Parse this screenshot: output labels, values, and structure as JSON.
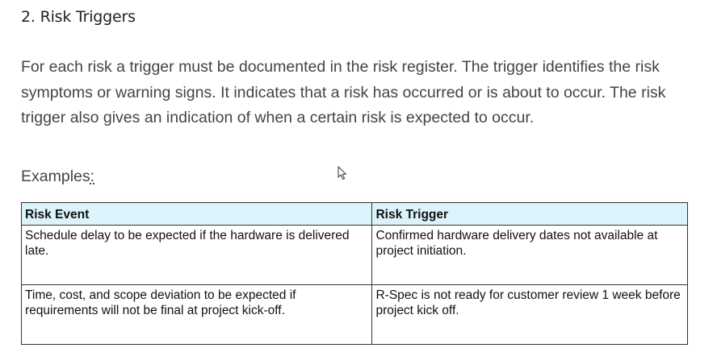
{
  "section": {
    "heading": "2. Risk Triggers",
    "paragraph": "For each risk a trigger must be documented in the risk register. The trigger identifies the risk symptoms or warning signs. It indicates that a risk has occurred or is about to occur. The risk trigger also gives an indication of when a certain risk is expected to occur.",
    "examples_label": "Examples",
    "examples_colon": ":"
  },
  "table": {
    "headers": [
      "Risk Event",
      "Risk Trigger"
    ],
    "rows": [
      [
        "Schedule delay to be expected if the hardware is delivered late.",
        "Confirmed hardware delivery dates not available at project initiation."
      ],
      [
        "Time, cost, and scope deviation to be expected if requirements will not be final at project kick-off.",
        "R-Spec is not ready for customer review 1 week before project kick off."
      ]
    ]
  },
  "icons": {
    "cursor": "mouse-pointer-icon"
  },
  "colors": {
    "header_bg": "#dcf3fb",
    "border": "#333333",
    "body_text": "#444444"
  }
}
